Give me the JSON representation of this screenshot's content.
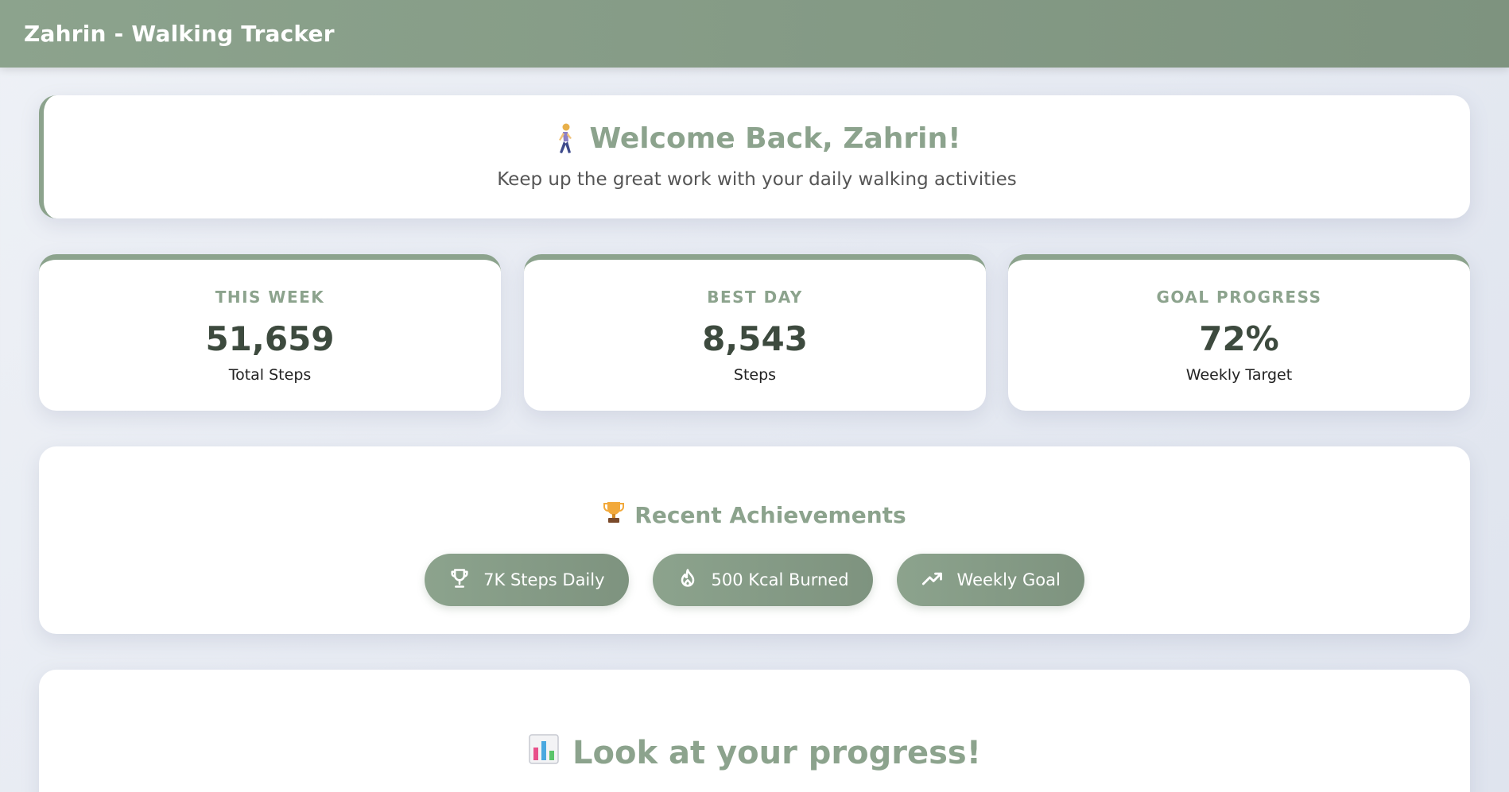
{
  "header": {
    "title": "Zahrin - Walking Tracker"
  },
  "welcome": {
    "icon": "person-walking-icon",
    "title": "Welcome Back, Zahrin!",
    "subtitle": "Keep up the great work with your daily walking activities"
  },
  "stats": [
    {
      "label": "THIS WEEK",
      "value": "51,659",
      "caption": "Total Steps"
    },
    {
      "label": "BEST DAY",
      "value": "8,543",
      "caption": "Steps"
    },
    {
      "label": "GOAL PROGRESS",
      "value": "72%",
      "caption": "Weekly Target"
    }
  ],
  "achievements": {
    "icon": "trophy-icon",
    "title": "Recent Achievements",
    "badges": [
      {
        "icon": "trophy-outline-icon",
        "label": "7K Steps Daily"
      },
      {
        "icon": "flame-icon",
        "label": "500 Kcal Burned"
      },
      {
        "icon": "trending-up-icon",
        "label": "Weekly Goal"
      }
    ]
  },
  "progress": {
    "icon": "bar-chart-icon",
    "title": "Look at your progress!"
  },
  "colors": {
    "accent": "#8ca38d",
    "accent_dark": "#7e937f",
    "value_text": "#3d4a3e",
    "background": "#e6eaf2"
  }
}
